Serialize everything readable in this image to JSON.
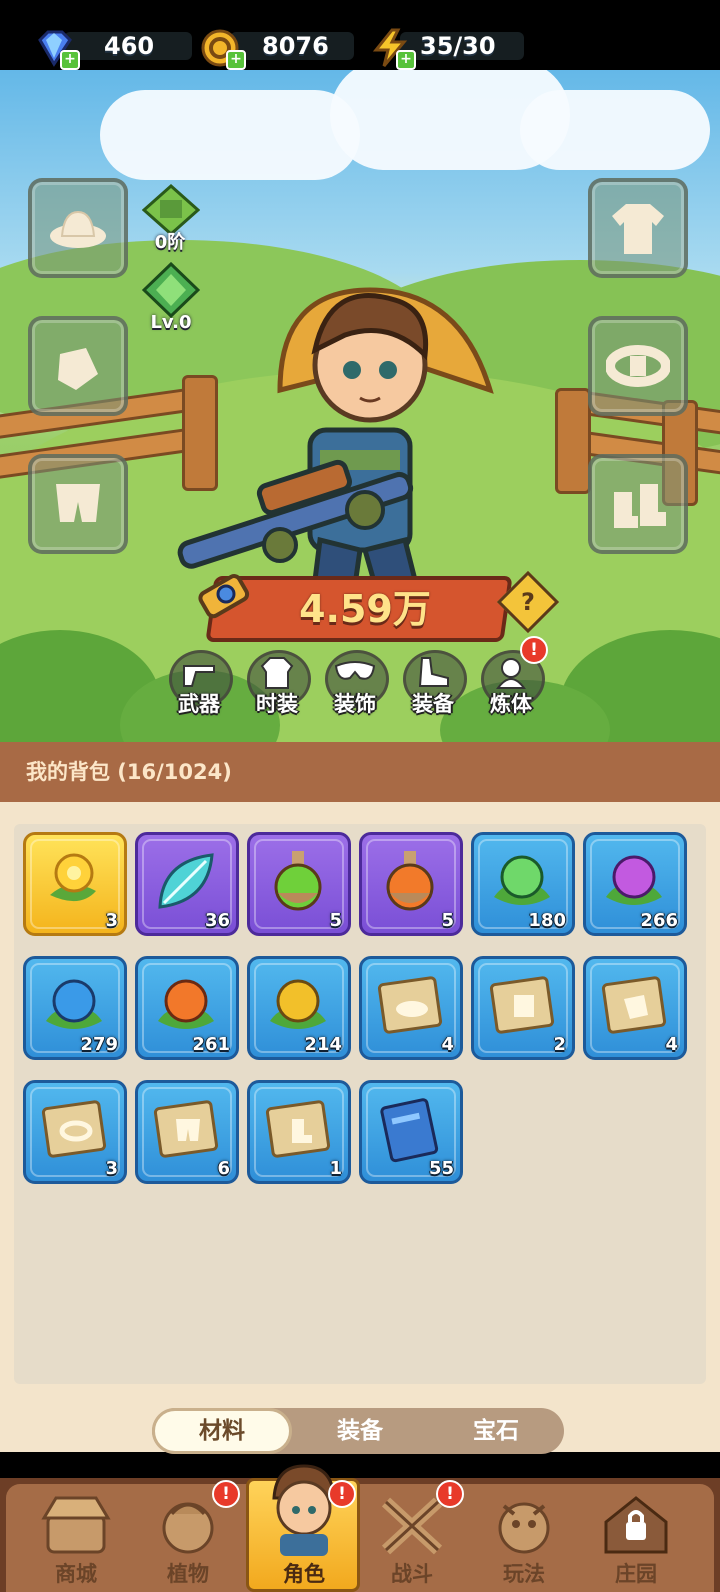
{
  "currencies": {
    "diamond": "460",
    "gold": "8076",
    "energy": "35/30"
  },
  "character": {
    "rank_label": "0阶",
    "level_label": "Lv.0",
    "power": "4.59万"
  },
  "char_menu": [
    {
      "label": "武器",
      "icon": "gun-icon"
    },
    {
      "label": "时装",
      "icon": "outfit-icon"
    },
    {
      "label": "装饰",
      "icon": "mask-icon"
    },
    {
      "label": "装备",
      "icon": "gear-equip-icon"
    },
    {
      "label": "炼体",
      "icon": "body-refine-icon",
      "alert": "!"
    }
  ],
  "backpack": {
    "title": "我的背包 (16/1024)",
    "items": [
      {
        "count": "3",
        "rarity": "gold",
        "icon": "golden-seed-icon"
      },
      {
        "count": "36",
        "rarity": "purple",
        "icon": "leaf-icon"
      },
      {
        "count": "5",
        "rarity": "purple",
        "icon": "green-potion-icon"
      },
      {
        "count": "5",
        "rarity": "purple",
        "icon": "orange-potion-icon"
      },
      {
        "count": "180",
        "rarity": "blue",
        "icon": "green-orb-icon"
      },
      {
        "count": "266",
        "rarity": "blue",
        "icon": "purple-orb-icon"
      },
      {
        "count": "279",
        "rarity": "blue",
        "icon": "blue-orb-icon"
      },
      {
        "count": "261",
        "rarity": "blue",
        "icon": "fire-orb-icon"
      },
      {
        "count": "214",
        "rarity": "blue",
        "icon": "lightning-orb-icon"
      },
      {
        "count": "4",
        "rarity": "blue",
        "icon": "hat-blueprint-icon"
      },
      {
        "count": "2",
        "rarity": "blue",
        "icon": "shirt-blueprint-icon"
      },
      {
        "count": "4",
        "rarity": "blue",
        "icon": "glove-blueprint-icon"
      },
      {
        "count": "3",
        "rarity": "blue",
        "icon": "belt-blueprint-icon"
      },
      {
        "count": "6",
        "rarity": "blue",
        "icon": "pants-blueprint-icon"
      },
      {
        "count": "1",
        "rarity": "blue",
        "icon": "boots-blueprint-icon"
      },
      {
        "count": "55",
        "rarity": "blue",
        "icon": "book-icon"
      }
    ]
  },
  "tabs": [
    {
      "label": "材料",
      "active": true
    },
    {
      "label": "装备",
      "active": false
    },
    {
      "label": "宝石",
      "active": false
    }
  ],
  "nav": [
    {
      "label": "商城",
      "icon": "shop-icon",
      "alert": ""
    },
    {
      "label": "植物",
      "icon": "plant-icon",
      "alert": "!"
    },
    {
      "label": "角色",
      "icon": "hero-icon",
      "alert": "!",
      "active": true
    },
    {
      "label": "战斗",
      "icon": "battle-icon",
      "alert": "!"
    },
    {
      "label": "玩法",
      "icon": "gameplay-icon",
      "alert": ""
    },
    {
      "label": "庄园",
      "icon": "manor-lock-icon",
      "alert": ""
    }
  ],
  "colors": {
    "gold_rarity": "#f4b41c",
    "purple_rarity": "#7a4fd6",
    "blue_rarity": "#2f8fd8",
    "alert": "#e83a2a"
  }
}
